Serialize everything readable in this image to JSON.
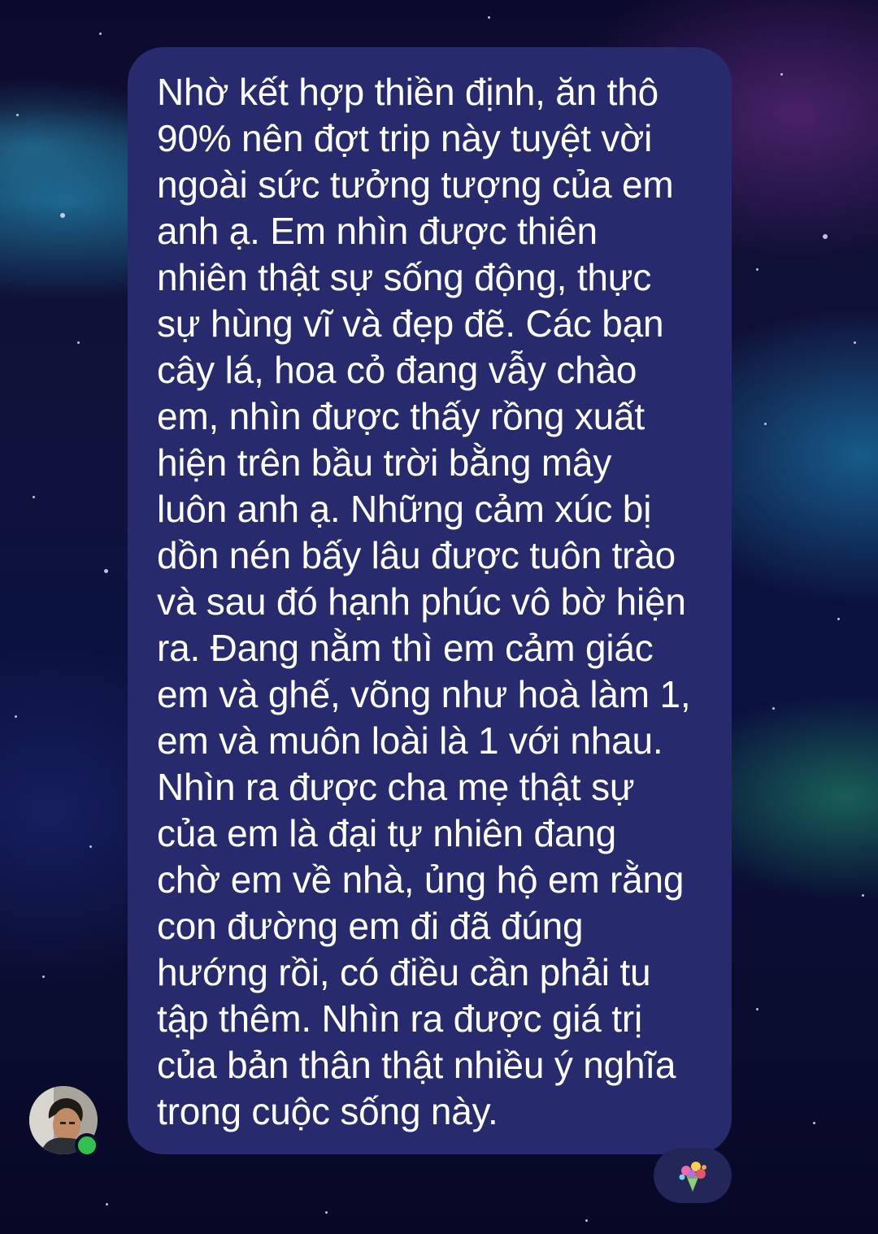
{
  "message": {
    "text": "Nhờ kết hợp thiền định, ăn thô\n90% nên đợt trip này tuyệt vời\nngoài sức tưởng tượng của em\nanh ạ. Em nhìn được thiên\nnhiên thật sự sống động, thực\nsự hùng vĩ và đẹp đẽ. Các bạn\ncây lá, hoa cỏ đang vẫy chào\nem, nhìn được thấy rồng xuất\nhiện trên bầu trời bằng mây\nluôn anh ạ. Những cảm xúc bị\ndồn nén bấy lâu được tuôn trào\nvà sau đó hạnh phúc vô bờ hiện\nra. Đang nằm thì em cảm giác\nem và ghế, võng như hoà làm 1,\nem và muôn loài là 1 với nhau.\nNhìn ra được cha mẹ thật sự\ncủa em là đại tự nhiên đang\nchờ em về nhà, ủng hộ em rằng\ncon đường em đi đã đúng\nhướng rồi, có điều cần phải tu\ntập thêm. Nhìn ra được giá trị\ncủa bản thân thật nhiều ý nghĩa\ntrong cuộc sống này."
  },
  "sender": {
    "avatar_icon": "person-avatar",
    "online": true,
    "online_color": "#31c24d"
  },
  "reaction": {
    "icon": "bouquet-icon",
    "emoji": "💐"
  },
  "colors": {
    "bubble": "#272a6c",
    "text": "#ffffff",
    "background": "#0c0a2c"
  }
}
